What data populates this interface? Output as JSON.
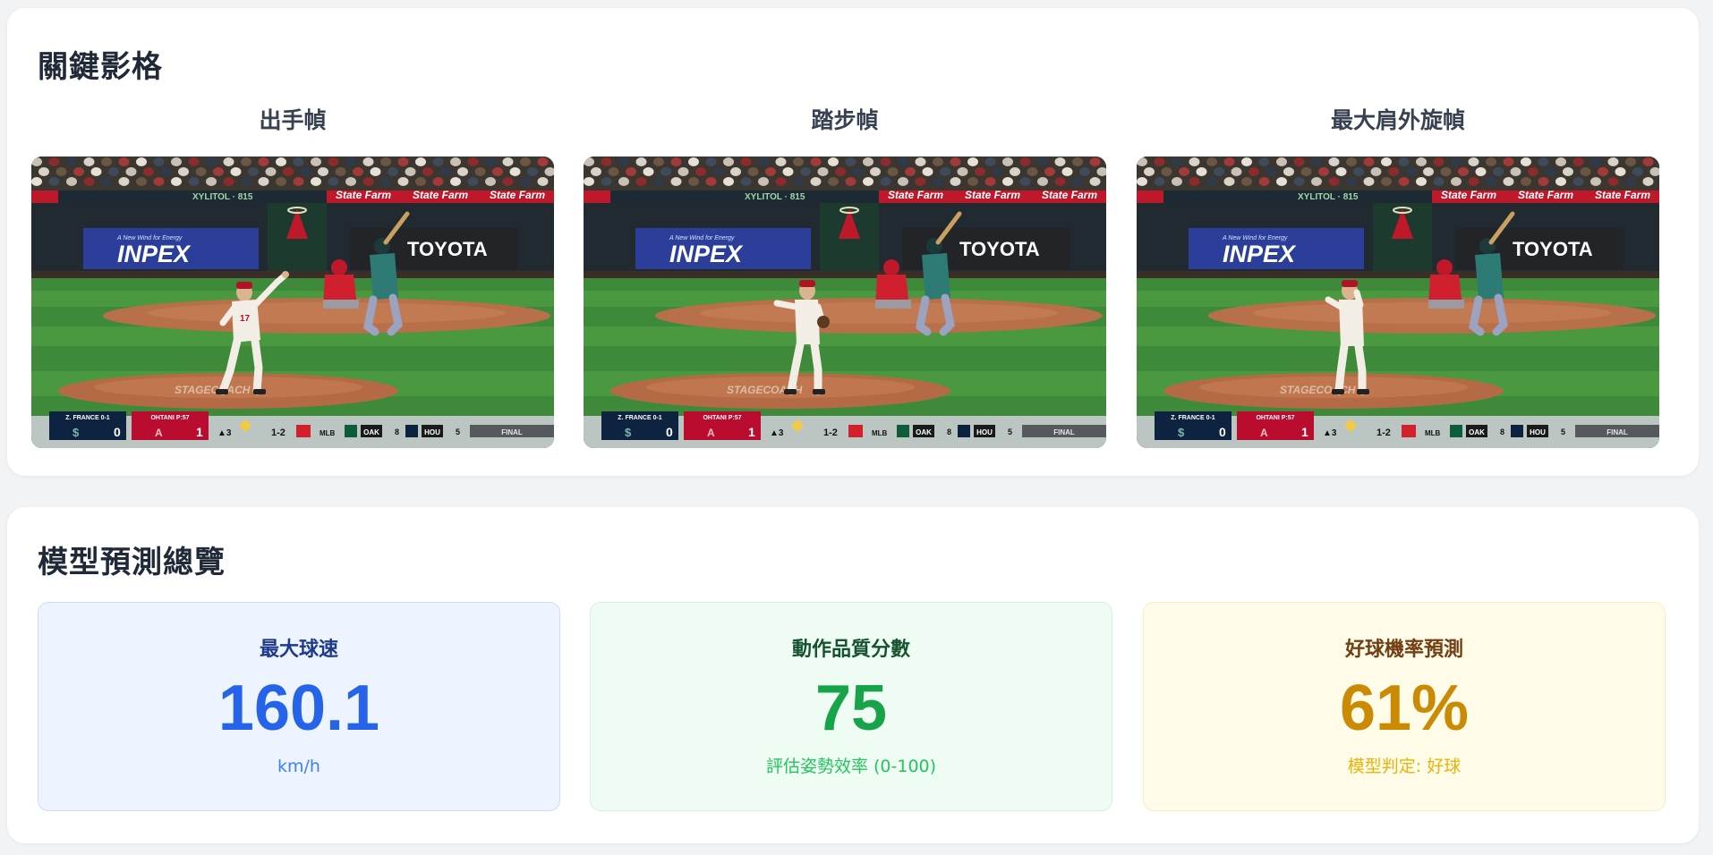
{
  "key_frames": {
    "title": "關鍵影格",
    "frames": [
      {
        "label": "出手幀"
      },
      {
        "label": "踏步幀"
      },
      {
        "label": "最大肩外旋幀"
      }
    ],
    "scene": {
      "sponsor_left": "INPEX",
      "sponsor_left_tag": "A New Wind for Energy",
      "sponsor_right": "TOYOTA",
      "ribbon": "State Farm",
      "ribbon_left": "XYLITOL · 815",
      "scoreboard": {
        "away_label": "Z. FRANCE 0-1",
        "away_score": "0",
        "home_label": "OHTANI P:57",
        "home_score": "1",
        "inning": "▲3",
        "count": "1-2",
        "ticker_1": "MLB",
        "ticker_2": "OAK",
        "ticker_2_score": "8",
        "ticker_3": "HOU",
        "ticker_3_score": "5",
        "ticker_status": "FINAL"
      }
    }
  },
  "predictions": {
    "title": "模型預測總覽",
    "cards": [
      {
        "label": "最大球速",
        "value": "160.1",
        "sub": "km/h",
        "color": "#2563eb"
      },
      {
        "label": "動作品質分數",
        "value": "75",
        "sub": "評估姿勢效率 (0-100)",
        "color": "#16a34a"
      },
      {
        "label": "好球機率預測",
        "value": "61%",
        "sub": "模型判定: 好球",
        "color": "#ca8a04"
      }
    ]
  }
}
